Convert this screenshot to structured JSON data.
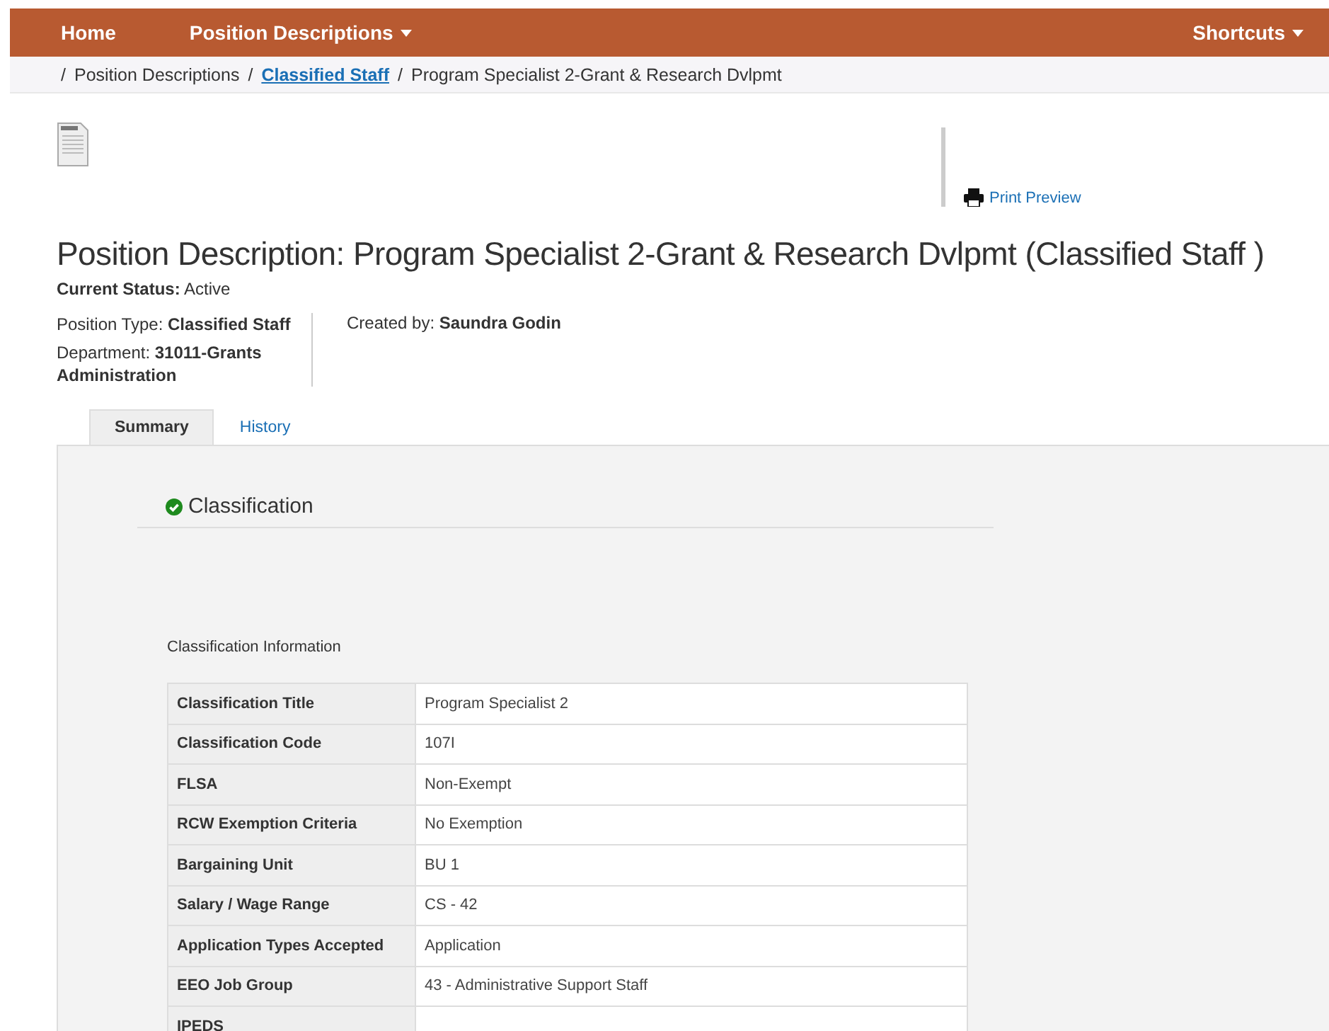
{
  "nav": {
    "items": [
      {
        "label": "Home",
        "dropdown": false
      },
      {
        "label": "Position Descriptions",
        "dropdown": true
      }
    ],
    "right": {
      "label": "Shortcuts",
      "dropdown": true
    }
  },
  "breadcrumb": {
    "separator": "/",
    "items": [
      {
        "label": "Position Descriptions",
        "link": false
      },
      {
        "label": "Classified Staff",
        "link": true
      },
      {
        "label": "Program Specialist 2-Grant & Research Dvlpmt",
        "link": false
      }
    ]
  },
  "print_link": "Print Preview",
  "title": "Position Description: Program Specialist 2-Grant & Research Dvlpmt (Classified Staff )",
  "status": {
    "label": "Current Status:",
    "value": "Active"
  },
  "details": [
    {
      "label": "Position Type:",
      "value": "Classified Staff"
    },
    {
      "label": "Department:",
      "value": "31011-Grants Administration"
    }
  ],
  "created_by": {
    "label": "Created by:",
    "value": "Saundra Godin"
  },
  "tabs": [
    {
      "label": "Summary",
      "selected": true
    },
    {
      "label": "History",
      "selected": false
    }
  ],
  "section": {
    "title": "Classification",
    "complete": true,
    "subtitle": "Classification Information",
    "rows": [
      {
        "label": "Classification Title",
        "value": "Program Specialist 2"
      },
      {
        "label": "Classification Code",
        "value": "107I"
      },
      {
        "label": "FLSA",
        "value": "Non-Exempt"
      },
      {
        "label": "RCW Exemption Criteria",
        "value": "No Exemption"
      },
      {
        "label": "Bargaining Unit",
        "value": "BU 1"
      },
      {
        "label": "Salary / Wage Range",
        "value": "CS - 42"
      },
      {
        "label": "Application Types Accepted",
        "value": "Application"
      },
      {
        "label": "EEO Job Group",
        "value": "43 - Administrative Support Staff"
      },
      {
        "label": "IPEDS"
      }
    ]
  }
}
